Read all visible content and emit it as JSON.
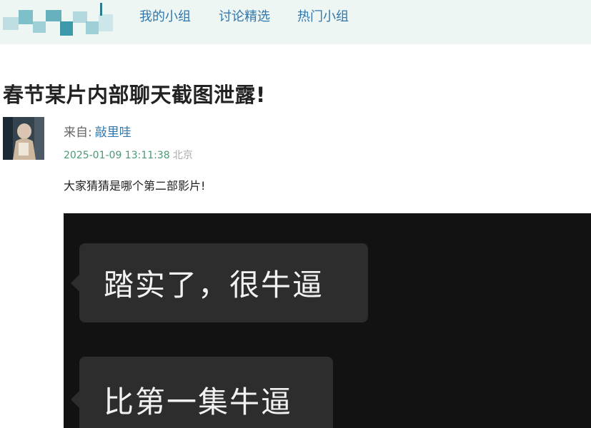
{
  "nav": {
    "items": [
      "我的小组",
      "讨论精选",
      "热门小组"
    ]
  },
  "post": {
    "title": "春节某片内部聊天截图泄露!",
    "from_label": "来自:",
    "author": "敲里哇",
    "datetime": "2025-01-09 13:11:38",
    "location": "北京",
    "content": "大家猜猜是哪个第二部影片!"
  },
  "chat": {
    "messages": [
      "踏实了，很牛逼",
      "比第一集牛逼"
    ]
  },
  "colors": {
    "link": "#3377aa",
    "topbar": "#eef6f3",
    "chat_bg": "#121212",
    "bubble": "#2d2d2d"
  }
}
